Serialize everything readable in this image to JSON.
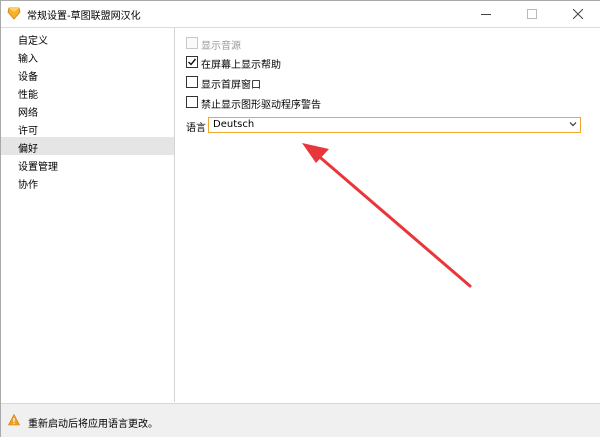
{
  "window": {
    "title": "常规设置-草图联盟网汉化"
  },
  "sidebar": {
    "items": [
      {
        "label": "自定义"
      },
      {
        "label": "输入"
      },
      {
        "label": "设备"
      },
      {
        "label": "性能"
      },
      {
        "label": "网络"
      },
      {
        "label": "许可"
      },
      {
        "label": "偏好",
        "selected": true
      },
      {
        "label": "设置管理"
      },
      {
        "label": "协作"
      }
    ]
  },
  "preferences": {
    "options": [
      {
        "label": "显示音源",
        "checked": false,
        "disabled": true
      },
      {
        "label": "在屏幕上显示帮助",
        "checked": true,
        "disabled": false
      },
      {
        "label": "显示首屏窗口",
        "checked": false,
        "disabled": false
      },
      {
        "label": "禁止显示图形驱动程序警告",
        "checked": false,
        "disabled": false
      }
    ],
    "language_label": "语言",
    "language_value": "Deutsch"
  },
  "status": {
    "message": "重新启动后将应用语言更改。"
  },
  "colors": {
    "accent": "#f0a830",
    "arrow": "#e8363b",
    "selected_bg": "#e5e5e5",
    "warning": "#f0a020"
  },
  "icons": {
    "app": "sketchup-gem-icon",
    "warning": "warning-triangle-icon",
    "dropdown": "chevron-down-icon"
  }
}
